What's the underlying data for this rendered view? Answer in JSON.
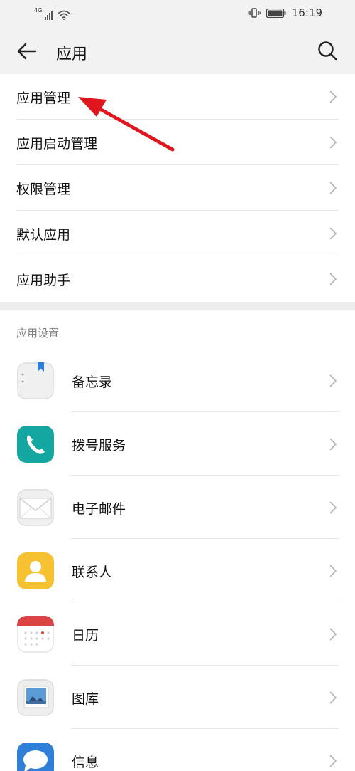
{
  "status_bar": {
    "network": "4G",
    "time": "16:19"
  },
  "header": {
    "title": "应用",
    "back_icon": "arrow-left-icon",
    "search_icon": "search-icon"
  },
  "menu": [
    {
      "label": "应用管理"
    },
    {
      "label": "应用启动管理"
    },
    {
      "label": "权限管理"
    },
    {
      "label": "默认应用"
    },
    {
      "label": "应用助手"
    }
  ],
  "section_title": "应用设置",
  "apps": [
    {
      "label": "备忘录",
      "icon": "notepad-icon"
    },
    {
      "label": "拨号服务",
      "icon": "phone-icon"
    },
    {
      "label": "电子邮件",
      "icon": "email-icon"
    },
    {
      "label": "联系人",
      "icon": "contacts-icon"
    },
    {
      "label": "日历",
      "icon": "calendar-icon"
    },
    {
      "label": "图库",
      "icon": "gallery-icon"
    },
    {
      "label": "信息",
      "icon": "messages-icon"
    }
  ],
  "colors": {
    "annotation_arrow": "#e0161e",
    "phone_bg": "#14a6a0",
    "contacts_bg": "#f6c232",
    "calendar_top": "#d94545",
    "messages_bg": "#2f7fd8"
  }
}
